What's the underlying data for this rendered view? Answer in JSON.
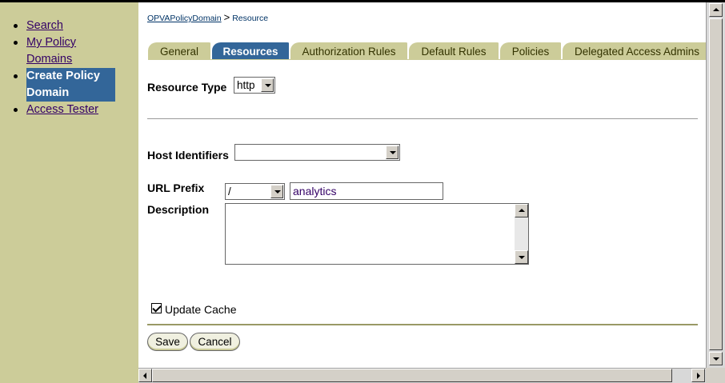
{
  "sidebar": {
    "items": [
      {
        "label": "Search"
      },
      {
        "label": "My Policy Domains"
      },
      {
        "label": "Create Policy Domain"
      },
      {
        "label": "Access Tester"
      }
    ]
  },
  "breadcrumb": {
    "root": "OPVAPolicyDomain",
    "separator": ">",
    "current": "Resource"
  },
  "tabs": [
    {
      "label": "General"
    },
    {
      "label": "Resources"
    },
    {
      "label": "Authorization Rules"
    },
    {
      "label": "Default Rules"
    },
    {
      "label": "Policies"
    },
    {
      "label": "Delegated Access Admins"
    }
  ],
  "form": {
    "resource_type_label": "Resource Type",
    "resource_type_value": "http",
    "host_identifiers_label": "Host Identifiers",
    "host_identifiers_value": "",
    "url_prefix_label": "URL Prefix",
    "url_prefix_select": "/",
    "url_prefix_value": "analytics",
    "description_label": "Description",
    "update_cache_label": "Update Cache"
  },
  "buttons": {
    "save": "Save",
    "cancel": "Cancel"
  },
  "colors": {
    "sidebar_bg": "#cccc99",
    "tab_active": "#336699",
    "tab_inactive": "#cccc99"
  }
}
